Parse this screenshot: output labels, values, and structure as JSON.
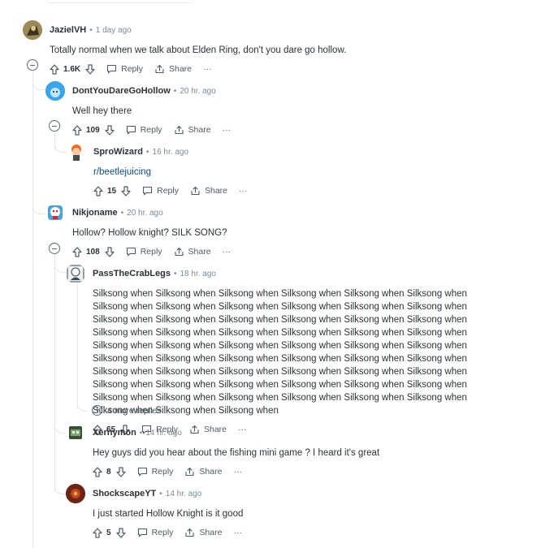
{
  "comments": [
    {
      "username": "JazielVH",
      "time": "1 day ago",
      "body": "Totally normal when we talk about Elden Ring, don't you dare go hollow.",
      "votes": "1.6K"
    },
    {
      "username": "DontYouDareGoHollow",
      "time": "20 hr. ago",
      "body": "Well hey there",
      "votes": "109"
    },
    {
      "username": "SproWizard",
      "time": "16 hr. ago",
      "body": "r/beetlejuicing",
      "votes": "15"
    },
    {
      "username": "Nikjoname",
      "time": "20 hr. ago",
      "body": "Hollow? Hollow knight? SILK SONG?",
      "votes": "108"
    },
    {
      "username": "PassTheCrabLegs",
      "time": "18 hr. ago",
      "body": "Silksong when Silksong when Silksong when Silksong when Silksong when Silksong when Silksong when Silksong when Silksong when Silksong when Silksong when Silksong when Silksong when Silksong when Silksong when Silksong when Silksong when Silksong when Silksong when Silksong when Silksong when Silksong when Silksong when Silksong when Silksong when Silksong when Silksong when Silksong when Silksong when Silksong when Silksong when Silksong when Silksong when Silksong when Silksong when Silksong when Silksong when Silksong when Silksong when Silksong when Silksong when Silksong when Silksong when Silksong when Silksong when Silksong when Silksong when Silksong when Silksong when Silksong when Silksong when Silksong when Silksong when Silksong when Silksong when Silksong when Silksong when",
      "votes": "65"
    },
    {
      "username": "Xernymon",
      "time": "14 hr. ago",
      "body": "Hey guys did you hear about the fishing mini game ? I heard it's great",
      "votes": "8"
    },
    {
      "username": "ShockscapeYT",
      "time": "14 hr. ago",
      "body": "I just started Hollow Knight is it good",
      "votes": "5"
    }
  ],
  "labels": {
    "reply": "Reply",
    "share": "Share",
    "overflow": "···",
    "separator": "•"
  },
  "more_replies": "4 more replies",
  "icons": [
    "upvote-icon",
    "downvote-icon",
    "reply-icon",
    "share-icon",
    "overflow-icon",
    "collapse-icon",
    "expand-icon"
  ],
  "colors": {
    "text": "#2a3236",
    "meta": "#7c8b94",
    "thread_line": "#e5e7e8",
    "link": "#0f4c81"
  }
}
